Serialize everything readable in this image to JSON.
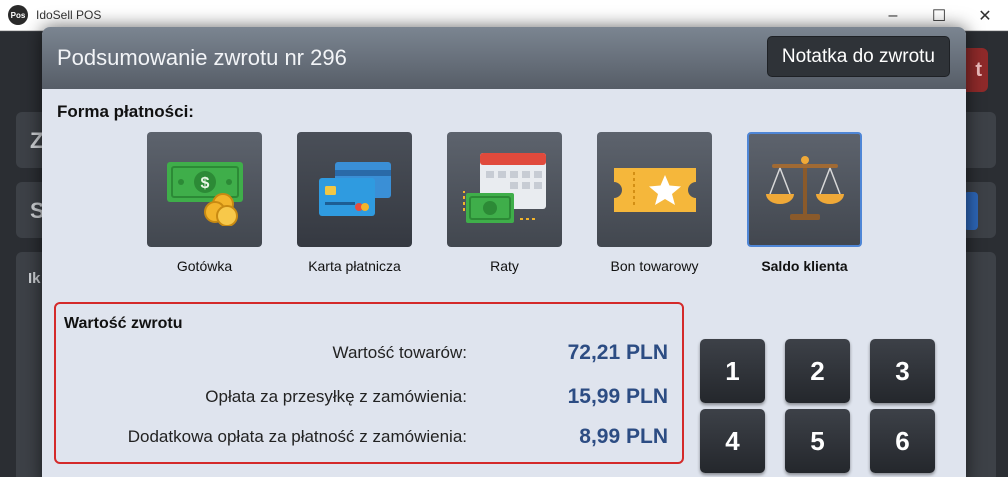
{
  "window": {
    "app_logo_text": "Pos",
    "title": "IdoSell POS",
    "minimize_glyph": "–",
    "maximize_glyph": "☐",
    "close_glyph": "✕"
  },
  "background": {
    "letters": [
      "Z",
      "S",
      "Ik"
    ],
    "red_button_partial": "t"
  },
  "modal": {
    "title": "Podsumowanie zwrotu nr 296",
    "note_button": "Notatka do zwrotu",
    "payment_label": "Forma płatności:",
    "methods": [
      {
        "label": "Gotówka",
        "icon": "cash-icon",
        "selected": false
      },
      {
        "label": "Karta płatnicza",
        "icon": "credit-card-icon",
        "selected": false
      },
      {
        "label": "Raty",
        "icon": "installments-icon",
        "selected": false
      },
      {
        "label": "Bon towarowy",
        "icon": "voucher-icon",
        "selected": false
      },
      {
        "label": "Saldo klienta",
        "icon": "scales-icon",
        "selected": true
      }
    ],
    "refund": {
      "title": "Wartość zwrotu",
      "rows": [
        {
          "label": "Wartość towarów:",
          "amount": "72,21 PLN"
        },
        {
          "label": "Opłata za przesyłkę z zamówienia:",
          "amount": "15,99 PLN"
        },
        {
          "label": "Dodatkowa opłata za płatność z zamówienia:",
          "amount": "8,99 PLN"
        }
      ]
    },
    "keypad": [
      "1",
      "2",
      "3",
      "4",
      "5",
      "6"
    ]
  },
  "colors": {
    "accent_blue": "#2c4c83",
    "highlight_red": "#d42a2a",
    "selected_border": "#4f86d6"
  }
}
